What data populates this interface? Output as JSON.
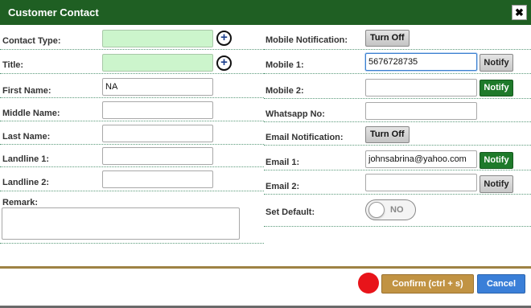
{
  "dialog": {
    "title": "Customer Contact",
    "close_glyph": "✖"
  },
  "left": {
    "contact_type": {
      "label": "Contact Type:",
      "value": ""
    },
    "title": {
      "label": "Title:",
      "value": ""
    },
    "first_name": {
      "label": "First Name:",
      "value": "NA"
    },
    "middle_name": {
      "label": "Middle Name:",
      "value": ""
    },
    "last_name": {
      "label": "Last Name:",
      "value": ""
    },
    "landline1": {
      "label": "Landline 1:",
      "value": ""
    },
    "landline2": {
      "label": "Landline 2:",
      "value": ""
    },
    "remark": {
      "label": "Remark:",
      "value": ""
    },
    "plus_glyph": "+"
  },
  "right": {
    "mobile_notification": {
      "label": "Mobile Notification:",
      "button": "Turn Off"
    },
    "mobile1": {
      "label": "Mobile 1:",
      "value": "5676728735",
      "notify": "Notify"
    },
    "mobile2": {
      "label": "Mobile 2:",
      "value": "",
      "notify": "Notify"
    },
    "whatsapp": {
      "label": "Whatsapp No:",
      "value": ""
    },
    "email_notification": {
      "label": "Email Notification:",
      "button": "Turn Off"
    },
    "email1": {
      "label": "Email 1:",
      "value": "johnsabrina@yahoo.com",
      "notify": "Notify"
    },
    "email2": {
      "label": "Email 2:",
      "value": "",
      "notify": "Notify"
    },
    "set_default": {
      "label": "Set Default:",
      "toggle": "NO"
    }
  },
  "footer": {
    "confirm": "Confirm (ctrl + s)",
    "cancel": "Cancel"
  },
  "colors": {
    "titlebar": "#1f5f23",
    "field_green": "#ccf5cc",
    "notify_green": "#1e7a2a",
    "confirm": "#c19343",
    "cancel": "#3a7fd8",
    "record_dot": "#e8141a"
  }
}
